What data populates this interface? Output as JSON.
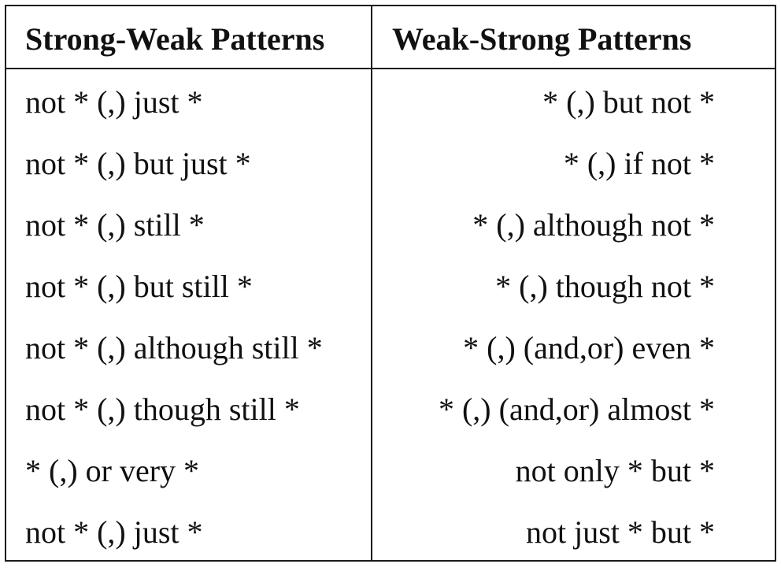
{
  "table": {
    "headers": [
      "Strong-Weak Patterns",
      "Weak-Strong Patterns"
    ],
    "strong_weak": [
      "not * (,) just *",
      "not * (,) but just *",
      "not * (,) still *",
      "not * (,) but still *",
      "not * (,) although still *",
      "not * (,) though still *",
      "* (,) or very *",
      "not * (,) just *"
    ],
    "weak_strong": [
      "* (,) but not *",
      "* (,) if not *",
      "* (,) although not *",
      "* (,) though not *",
      "* (,) (and,or) even *",
      "* (,) (and,or) almost *",
      "not only * but *",
      "not just * but *"
    ]
  }
}
